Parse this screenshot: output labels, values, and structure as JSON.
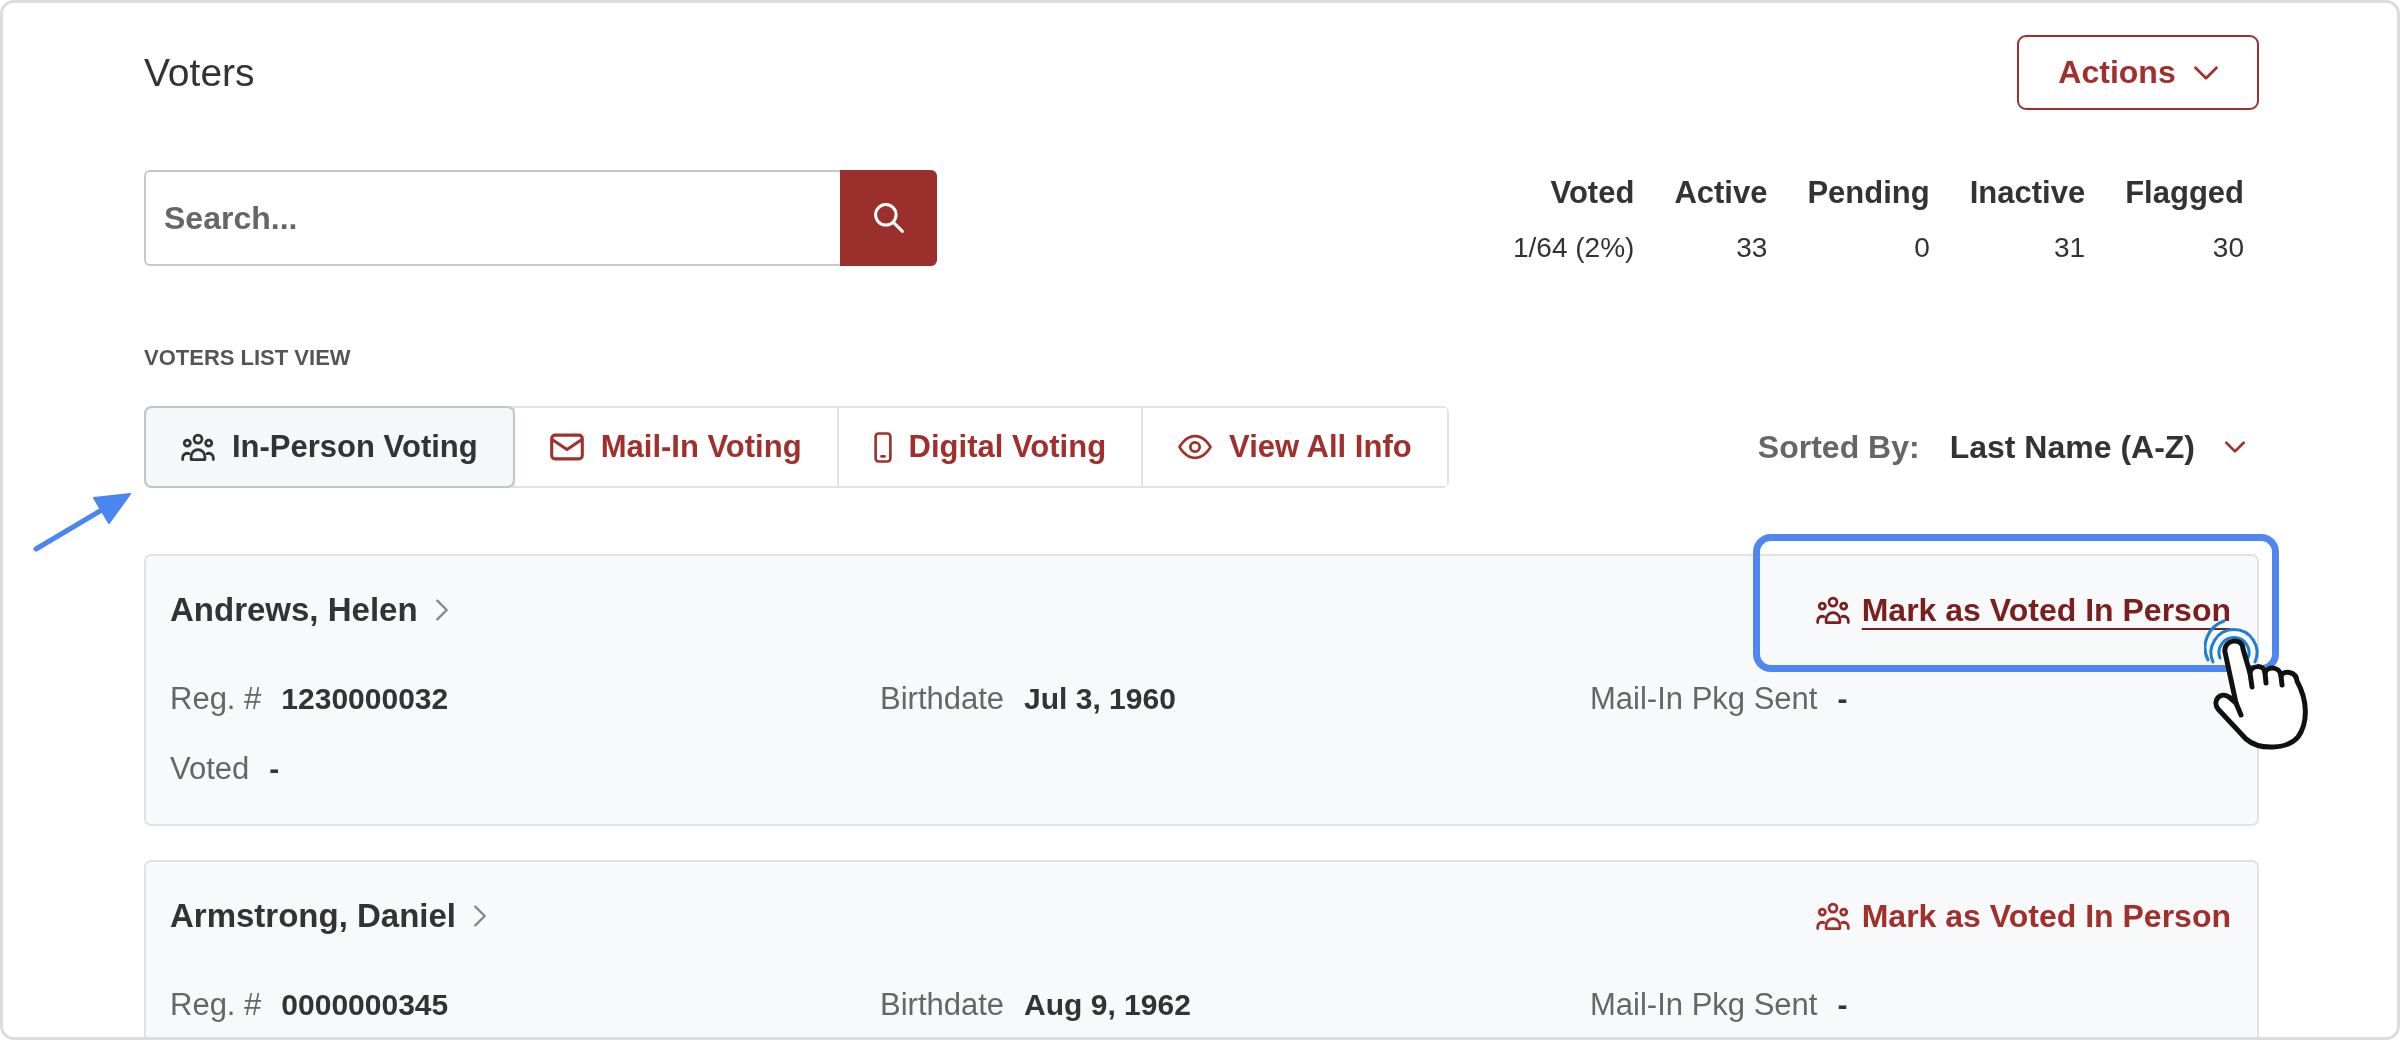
{
  "page": {
    "title": "Voters",
    "actions_button": "Actions"
  },
  "search": {
    "placeholder": "Search..."
  },
  "stats": [
    {
      "label": "Voted",
      "value": "1/64 (2%)"
    },
    {
      "label": "Active",
      "value": "33"
    },
    {
      "label": "Pending",
      "value": "0"
    },
    {
      "label": "Inactive",
      "value": "31"
    },
    {
      "label": "Flagged",
      "value": "30"
    }
  ],
  "list_view": {
    "heading": "VOTERS LIST VIEW",
    "tabs": [
      {
        "label": "In-Person Voting",
        "kind": "person",
        "selected": true,
        "annotated": true
      },
      {
        "label": "Mail-In Voting",
        "kind": "mail",
        "selected": false,
        "annotated": false
      },
      {
        "label": "Digital Voting",
        "kind": "digital",
        "selected": false,
        "annotated": false
      },
      {
        "label": "View All Info",
        "kind": "all",
        "selected": false,
        "annotated": false
      }
    ]
  },
  "sort": {
    "label": "Sorted By:",
    "value": "Last Name (A-Z)"
  },
  "voters": [
    {
      "name": "Andrews, Helen",
      "action": {
        "label": "Mark as Voted In Person",
        "hovered": true,
        "annotated": true
      },
      "rows": [
        [
          {
            "label": "Reg. #",
            "value": "1230000032"
          },
          {
            "label": "Birthdate",
            "value": "Jul 3, 1960"
          },
          {
            "label": "Mail-In Pkg Sent",
            "value": "-"
          }
        ],
        [
          {
            "label": "Voted",
            "value": "-"
          }
        ]
      ]
    },
    {
      "name": "Armstrong, Daniel",
      "action": {
        "label": "Mark as Voted In Person",
        "hovered": false,
        "annotated": false
      },
      "rows": [
        [
          {
            "label": "Reg. #",
            "value": "0000000345"
          },
          {
            "label": "Birthdate",
            "value": "Aug 9, 1962"
          },
          {
            "label": "Mail-In Pkg Sent",
            "value": "-"
          }
        ]
      ]
    }
  ]
}
